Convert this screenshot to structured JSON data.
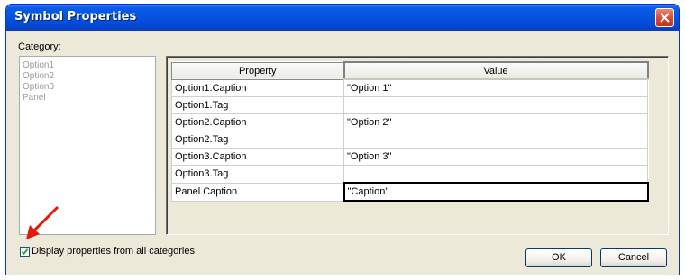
{
  "window": {
    "title": "Symbol Properties",
    "close_icon": "close-icon"
  },
  "category": {
    "label": "Category:",
    "items": [
      "Option1",
      "Option2",
      "Option3",
      "Panel"
    ]
  },
  "grid": {
    "headers": {
      "property": "Property",
      "value": "Value"
    },
    "rows": [
      {
        "property": "Option1.Caption",
        "value": "\"Option 1\""
      },
      {
        "property": "Option1.Tag",
        "value": ""
      },
      {
        "property": "Option2.Caption",
        "value": "\"Option 2\""
      },
      {
        "property": "Option2.Tag",
        "value": ""
      },
      {
        "property": "Option3.Caption",
        "value": "\"Option 3\""
      },
      {
        "property": "Option3.Tag",
        "value": ""
      },
      {
        "property": "Panel.Caption",
        "value": "\"Caption\""
      }
    ]
  },
  "display_all": {
    "label": "Display properties from all categories",
    "checked": true
  },
  "buttons": {
    "ok": "OK",
    "cancel": "Cancel"
  },
  "annotation": {
    "arrow_icon": "red-arrow-icon",
    "color": "#e8190b"
  }
}
